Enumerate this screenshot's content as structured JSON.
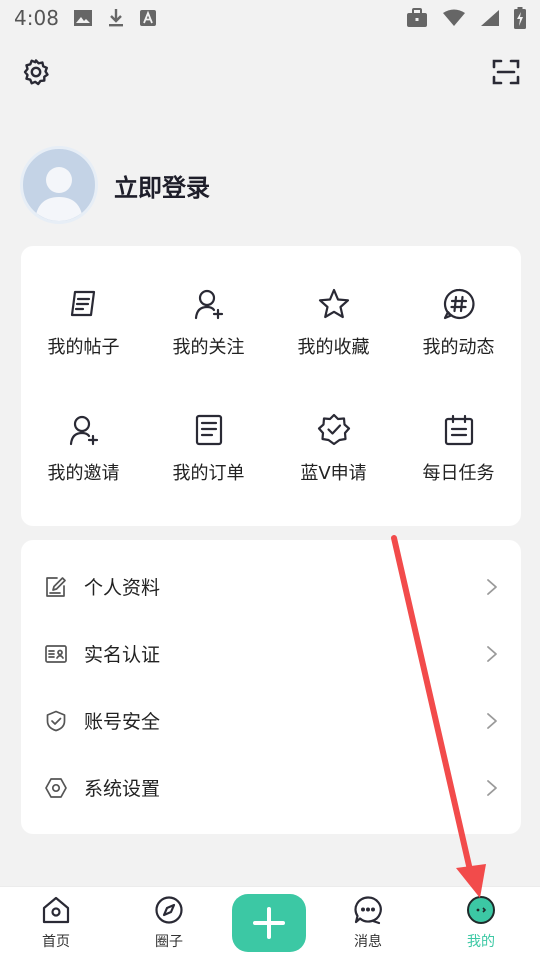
{
  "status_bar": {
    "time": "4:08"
  },
  "profile": {
    "login_label": "立即登录"
  },
  "grid": [
    {
      "label": "我的帖子",
      "icon": "posts-icon"
    },
    {
      "label": "我的关注",
      "icon": "follow-user-icon"
    },
    {
      "label": "我的收藏",
      "icon": "star-icon"
    },
    {
      "label": "我的动态",
      "icon": "hashtag-bubble-icon"
    },
    {
      "label": "我的邀请",
      "icon": "invite-user-icon"
    },
    {
      "label": "我的订单",
      "icon": "order-document-icon"
    },
    {
      "label": "蓝V申请",
      "icon": "verified-badge-icon"
    },
    {
      "label": "每日任务",
      "icon": "calendar-task-icon"
    }
  ],
  "list": [
    {
      "label": "个人资料",
      "icon": "edit-profile-icon"
    },
    {
      "label": "实名认证",
      "icon": "id-card-icon"
    },
    {
      "label": "账号安全",
      "icon": "shield-check-icon"
    },
    {
      "label": "系统设置",
      "icon": "hexagon-settings-icon"
    }
  ],
  "tabbar": {
    "home": "首页",
    "circle": "圈子",
    "messages": "消息",
    "mine": "我的"
  },
  "colors": {
    "accent": "#3cc8a4",
    "arrow": "#f24b4b"
  }
}
